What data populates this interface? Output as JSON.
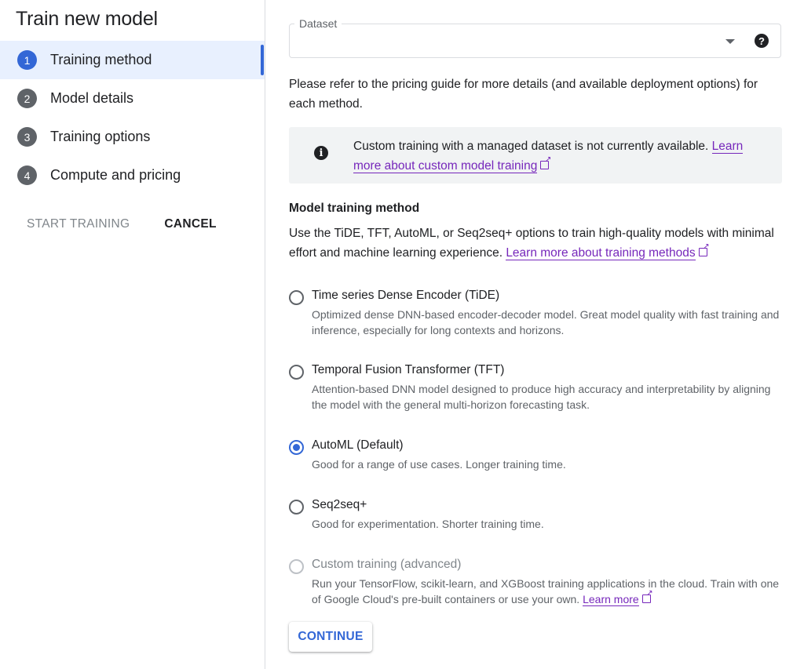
{
  "sidebar": {
    "title": "Train new model",
    "steps": [
      {
        "number": "1",
        "label": "Training method",
        "active": true
      },
      {
        "number": "2",
        "label": "Model details",
        "active": false
      },
      {
        "number": "3",
        "label": "Training options",
        "active": false
      },
      {
        "number": "4",
        "label": "Compute and pricing",
        "active": false
      }
    ],
    "start_training_label": "START TRAINING",
    "cancel_label": "CANCEL"
  },
  "main": {
    "dataset": {
      "label": "Dataset",
      "value": ""
    },
    "pricing_text": "Please refer to the pricing guide for more details (and available deployment options) for each method.",
    "notice": {
      "text": "Custom training with a managed dataset is not currently available.",
      "link_text": "Learn more about custom model training"
    },
    "section_title": "Model training method",
    "section_desc": "Use the TiDE, TFT, AutoML, or Seq2seq+ options to train high-quality models with minimal effort and machine learning experience.",
    "section_link": "Learn more about training methods",
    "options": [
      {
        "title": "Time series Dense Encoder (TiDE)",
        "desc": "Optimized dense DNN-based encoder-decoder model. Great model quality with fast training and inference, especially for long contexts and horizons.",
        "selected": false,
        "disabled": false
      },
      {
        "title": "Temporal Fusion Transformer (TFT)",
        "desc": "Attention-based DNN model designed to produce high accuracy and interpretability by aligning the model with the general multi-horizon forecasting task.",
        "selected": false,
        "disabled": false
      },
      {
        "title": "AutoML (Default)",
        "desc": "Good for a range of use cases. Longer training time.",
        "selected": true,
        "disabled": false
      },
      {
        "title": "Seq2seq+",
        "desc": "Good for experimentation. Shorter training time.",
        "selected": false,
        "disabled": false
      },
      {
        "title": "Custom training (advanced)",
        "desc": "Run your TensorFlow, scikit-learn, and XGBoost training applications in the cloud. Train with one of Google Cloud's pre-built containers or use your own.",
        "link_text": "Learn more",
        "selected": false,
        "disabled": true
      }
    ],
    "continue_label": "CONTINUE"
  },
  "colors": {
    "accent": "#3367d6",
    "link": "#7627bb",
    "notice_bg": "#f1f3f4",
    "active_step_bg": "#e8f0fe"
  },
  "icons": {
    "help": "help-circle-icon",
    "info": "info-icon",
    "external": "external-link-icon",
    "dropdown": "dropdown-arrow-icon"
  }
}
